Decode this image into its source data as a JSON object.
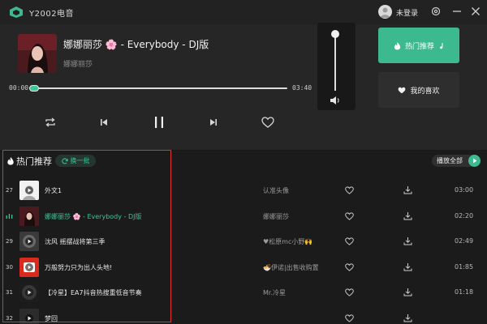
{
  "app": {
    "title": "Y2002电音",
    "login_label": "未登录"
  },
  "player": {
    "title": "娜娜丽莎 🌸 - Everybody - DJ版",
    "artist": "娜娜丽莎",
    "time_current": "00:00",
    "time_total": "03:40",
    "progress": 0.02,
    "volume": 0.95
  },
  "side": {
    "hot_label": "热门推荐",
    "fav_label": "我的喜欢"
  },
  "list": {
    "title": "热门推荐",
    "refresh_label": "换一批",
    "play_all_label": "播放全部",
    "rows": [
      {
        "index": "27",
        "name": "外文1",
        "artist": "认准头像",
        "duration": "03:00",
        "active": false
      },
      {
        "index": "",
        "name": "娜娜丽莎 🌸 - Everybody - DJ版",
        "artist": "娜娜丽莎",
        "duration": "02:20",
        "active": true
      },
      {
        "index": "29",
        "name": "沈风 摇摆战将第三季",
        "artist": "♥松原mc小野🙌",
        "duration": "02:49",
        "active": false
      },
      {
        "index": "30",
        "name": "万般努力只为出人头地!",
        "artist": "🍜伊诺|出售收购置",
        "duration": "01:85",
        "active": false
      },
      {
        "index": "31",
        "name": "【冷星】EA7抖音热搜重低音节奏",
        "artist": "Mr.冷星",
        "duration": "01:18",
        "active": false
      },
      {
        "index": "32",
        "name": "梦回",
        "artist": "",
        "duration": "",
        "active": false
      }
    ]
  },
  "colors": {
    "accent": "#3cc79a",
    "highlight": "#e23030"
  }
}
